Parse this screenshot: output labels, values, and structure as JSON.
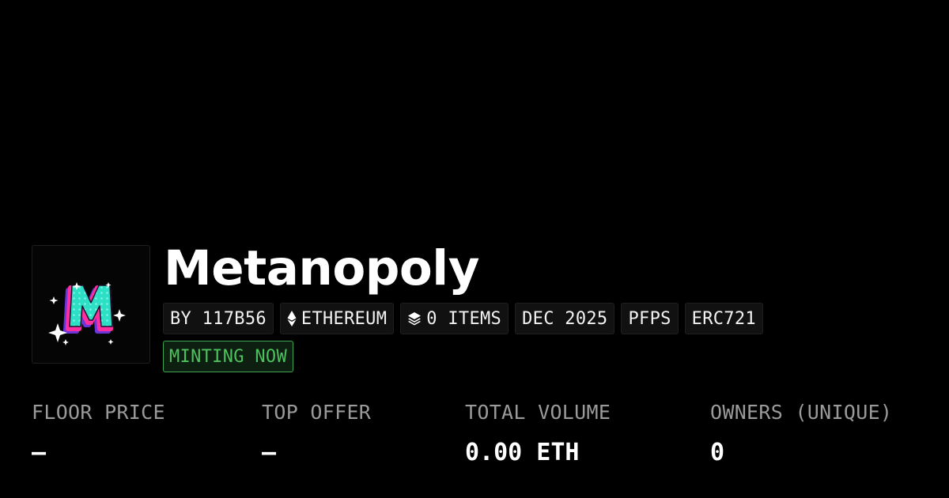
{
  "collection": {
    "logo_icon": "metanopoly-m-logo",
    "name": "Metanopoly",
    "tags": [
      {
        "label": "BY 117B56",
        "icon": null
      },
      {
        "label": "ETHEREUM",
        "icon": "ethereum-icon"
      },
      {
        "label": "0 ITEMS",
        "icon": "layers-icon"
      },
      {
        "label": "DEC 2025",
        "icon": null
      },
      {
        "label": "PFPS",
        "icon": null
      },
      {
        "label": "ERC721",
        "icon": null
      }
    ],
    "status": "MINTING NOW"
  },
  "stats": [
    {
      "label": "FLOOR PRICE",
      "value": "–"
    },
    {
      "label": "TOP OFFER",
      "value": "–"
    },
    {
      "label": "TOTAL VOLUME",
      "value": "0.00 ETH"
    },
    {
      "label": "OWNERS (UNIQUE)",
      "value": "0"
    }
  ],
  "colors": {
    "background": "#000000",
    "status_green": "#4fc05e",
    "logo_teal": "#2de0c5",
    "logo_pink": "#ff2fa0",
    "logo_purple": "#6a35d9"
  }
}
